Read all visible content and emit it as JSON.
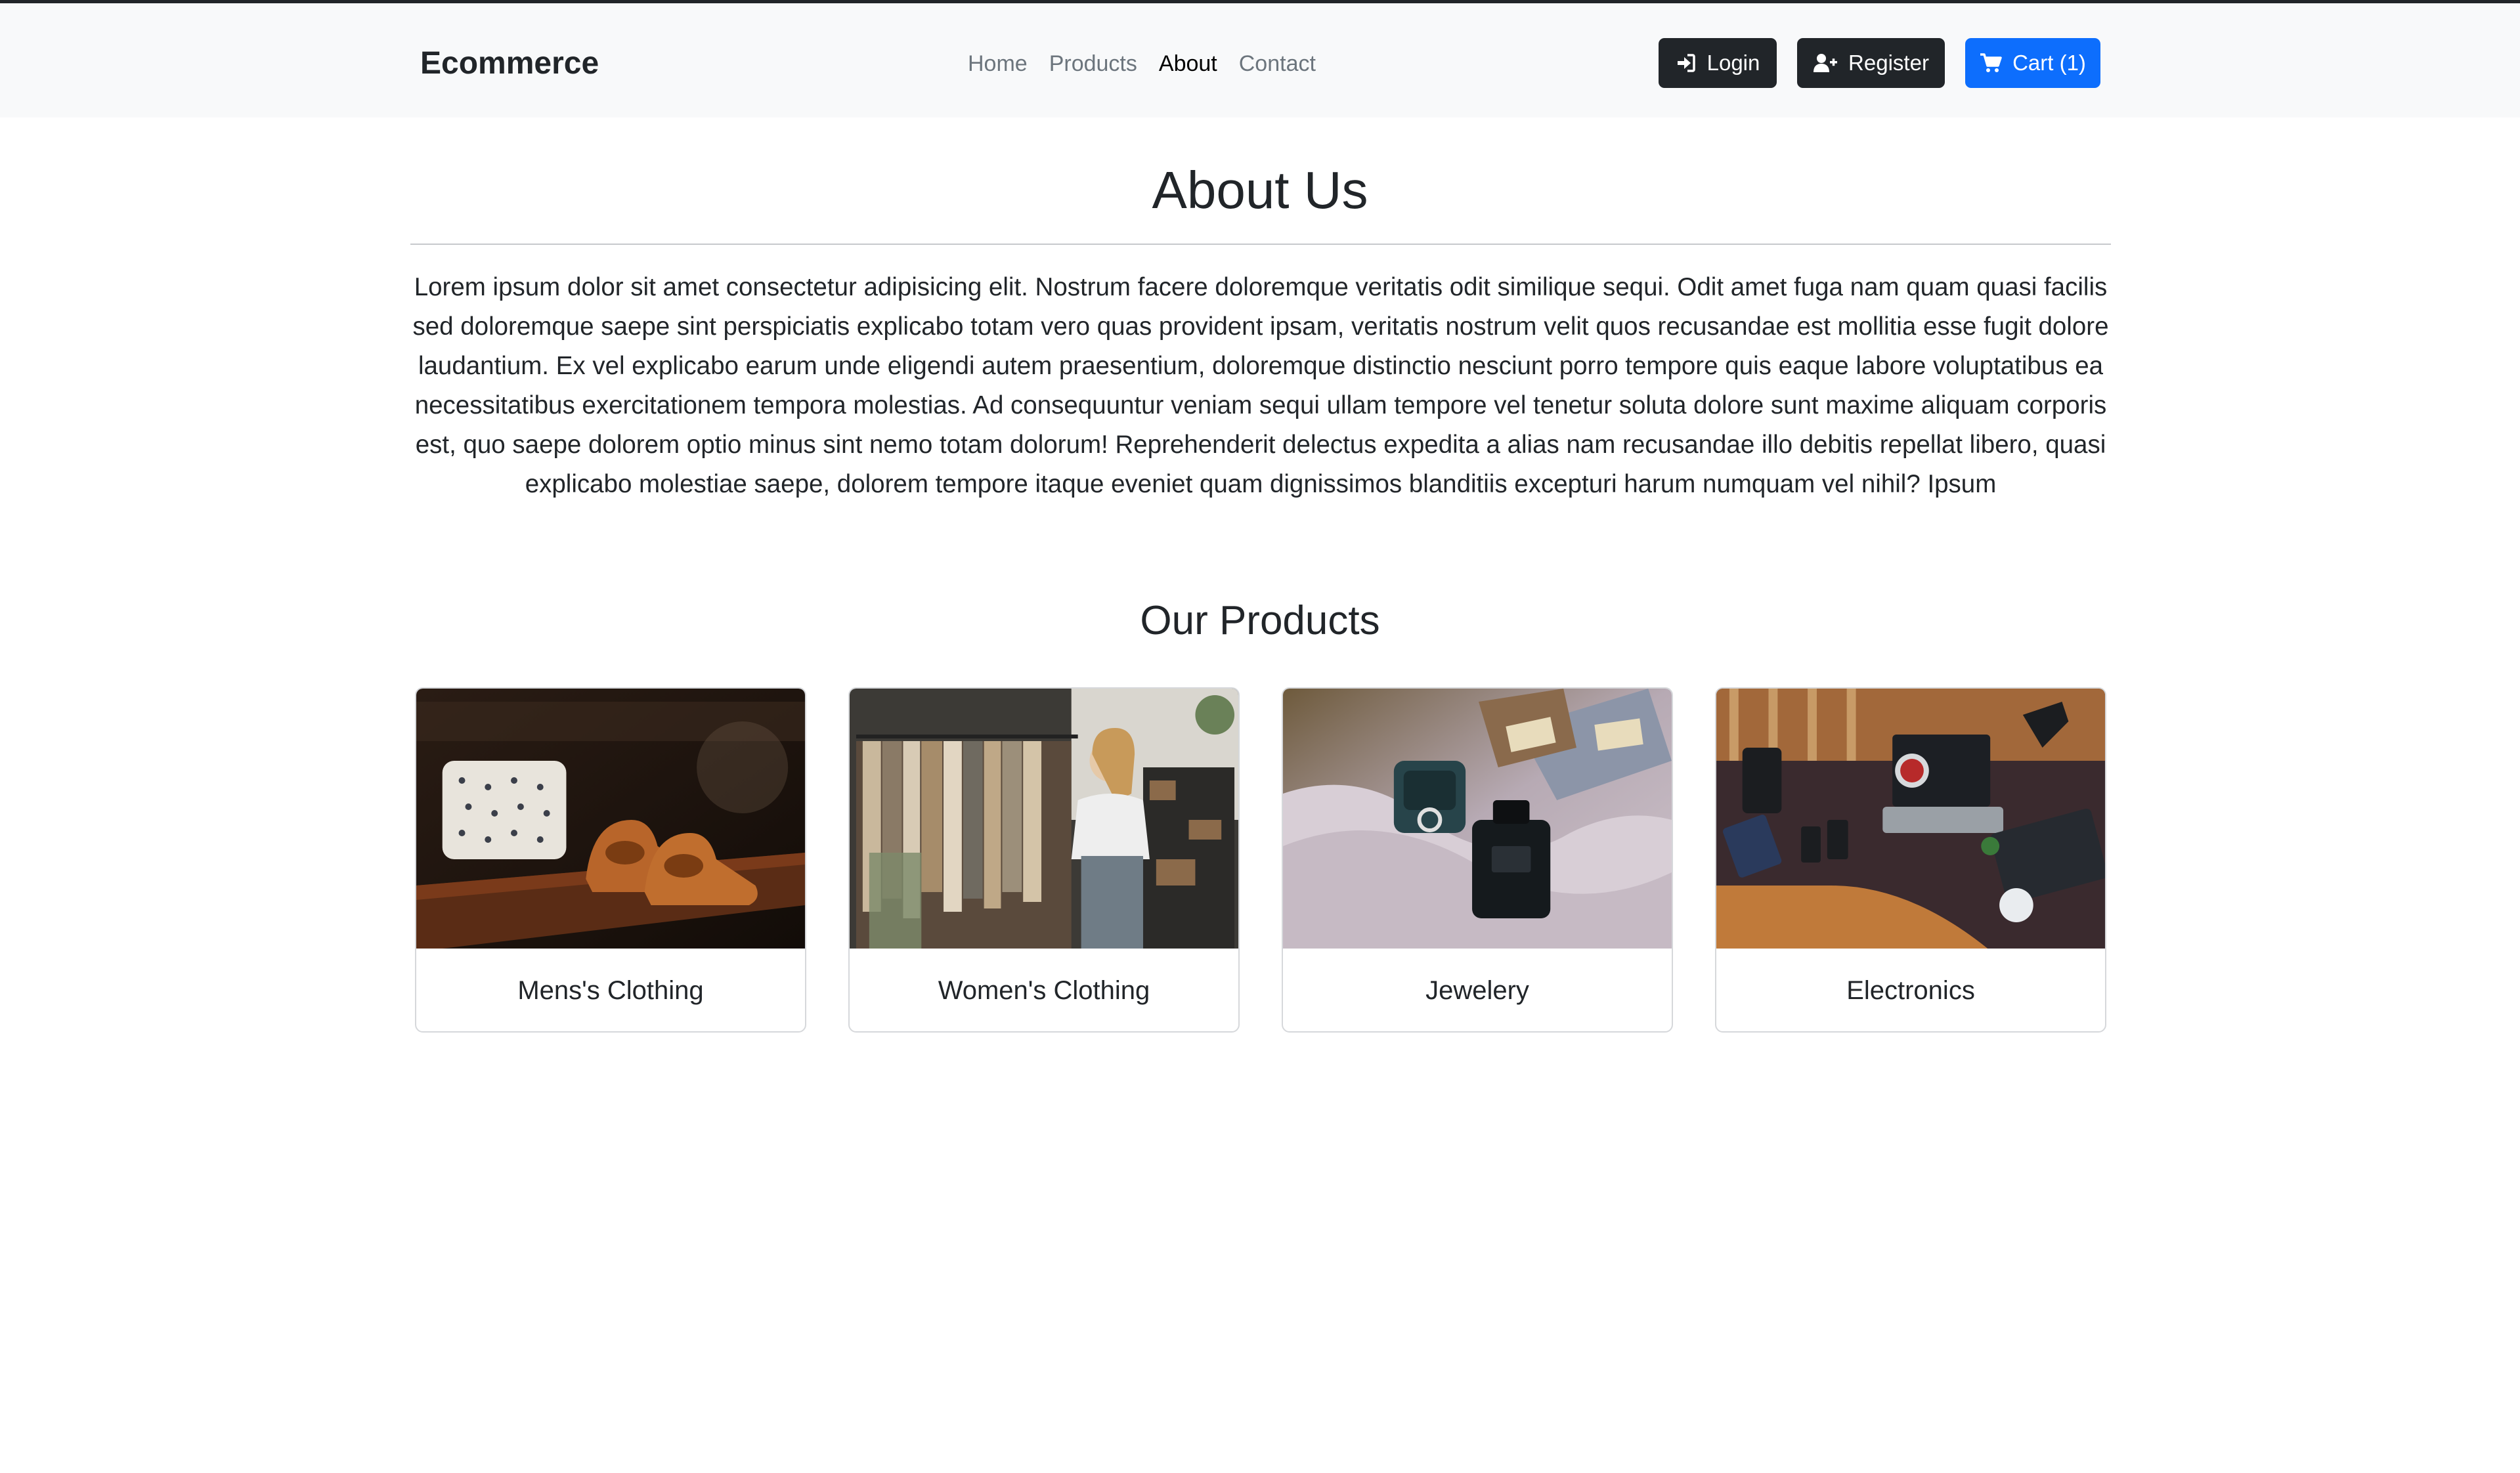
{
  "brand": "Ecommerce",
  "nav": {
    "links": [
      {
        "label": "Home"
      },
      {
        "label": "Products"
      },
      {
        "label": "About"
      },
      {
        "label": "Contact"
      }
    ],
    "login_label": "Login",
    "register_label": "Register",
    "cart_label": "Cart (1)"
  },
  "about": {
    "title": "About Us",
    "text": "Lorem ipsum dolor sit amet consectetur adipisicing elit. Nostrum facere doloremque veritatis odit similique sequi. Odit amet fuga nam quam quasi facilis sed doloremque saepe sint perspiciatis explicabo totam vero quas provident ipsam, veritatis nostrum velit quos recusandae est mollitia esse fugit dolore laudantium. Ex vel explicabo earum unde eligendi autem praesentium, doloremque distinctio nesciunt porro tempore quis eaque labore voluptatibus ea necessitatibus exercitationem tempora molestias. Ad consequuntur veniam sequi ullam tempore vel tenetur soluta dolore sunt maxime aliquam corporis est, quo saepe dolorem optio minus sint nemo totam dolorum! Reprehenderit delectus expedita a alias nam recusandae illo debitis repellat libero, quasi explicabo molestiae saepe, dolorem tempore itaque eveniet quam dignissimos blanditiis excepturi harum numquam vel nihil? Ipsum"
  },
  "products": {
    "title": "Our Products",
    "cards": [
      {
        "label": "Mens's Clothing"
      },
      {
        "label": "Women's Clothing"
      },
      {
        "label": "Jewelery"
      },
      {
        "label": "Electronics"
      }
    ]
  },
  "colors": {
    "primary": "#0d6efd",
    "dark": "#212529",
    "navbar_bg": "#f8f9fa",
    "nav_link_muted": "#6c757d"
  },
  "icons": {
    "login": "sign-in-icon",
    "register": "user-plus-icon",
    "cart": "shopping-cart-icon"
  }
}
